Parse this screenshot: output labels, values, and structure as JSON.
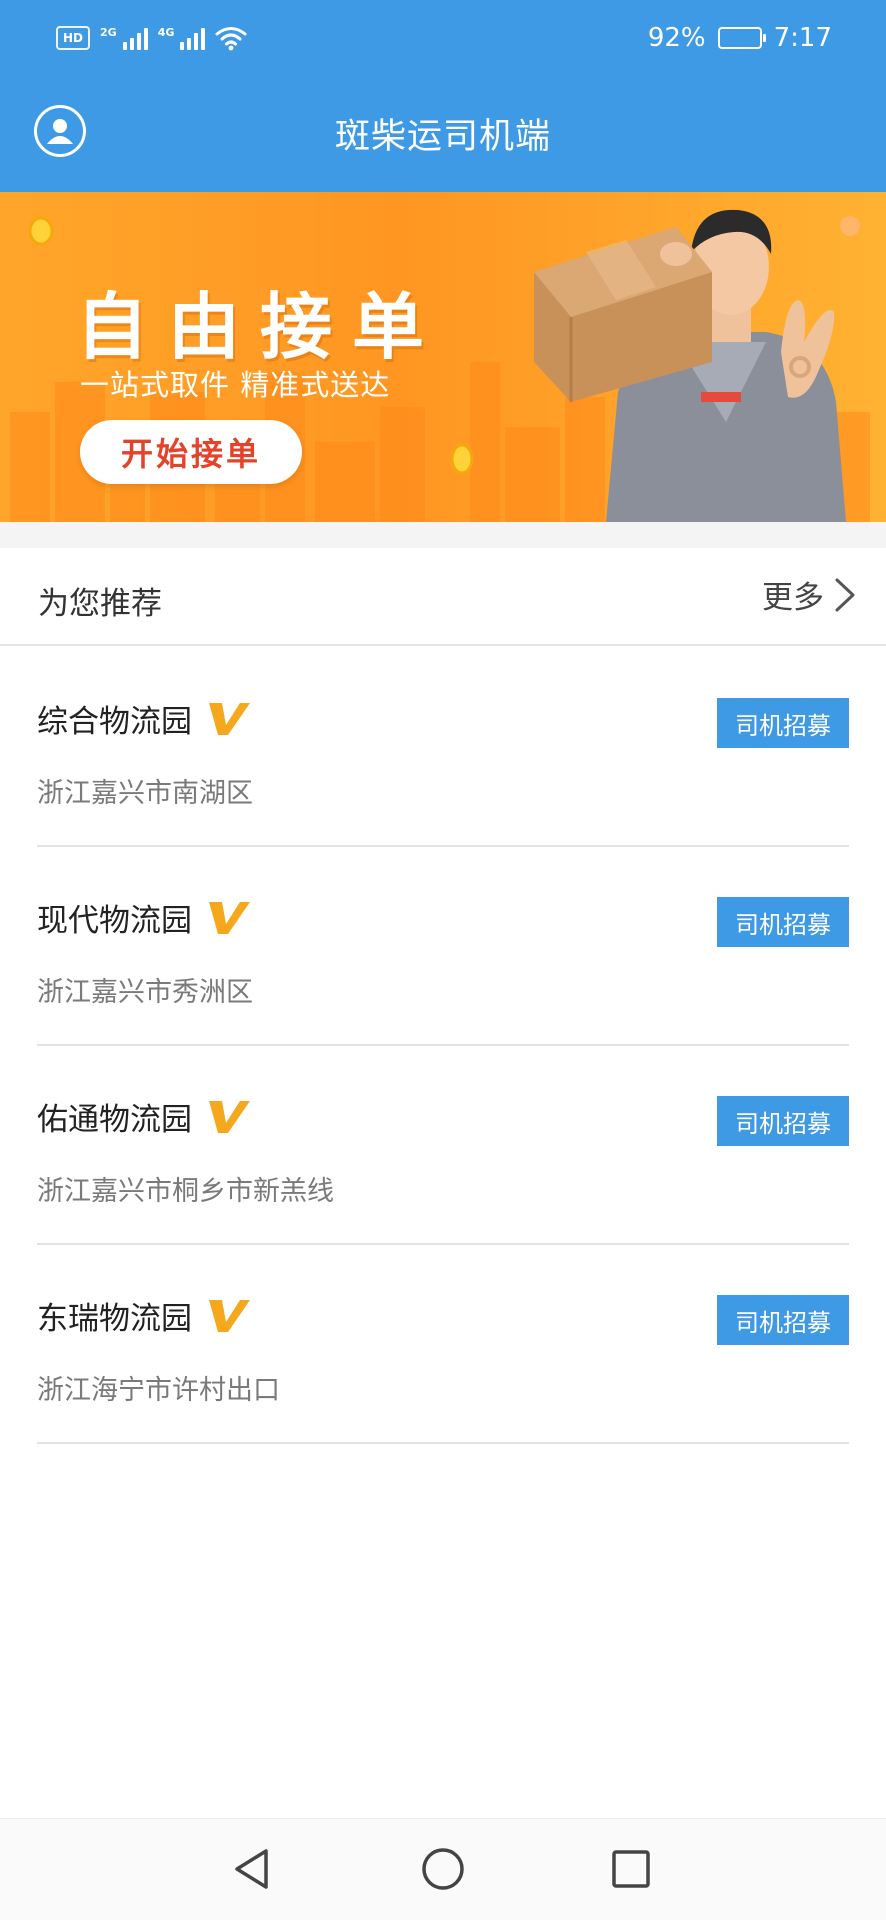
{
  "status_bar": {
    "hd_label": "HD",
    "hd_sub": "2",
    "net_1": "2G",
    "net_2": "4G",
    "battery_text": "92%",
    "battery_level": 0.92,
    "time": "7:17"
  },
  "header": {
    "title": "斑柴运司机端",
    "avatar_icon": "user-profile-icon"
  },
  "banner": {
    "headline": "自由接单",
    "subtitle": "一站式取件 精准式送达",
    "button_label": "开始接单"
  },
  "recommend": {
    "title": "为您推荐",
    "more_label": "更多",
    "more_icon": "chevron-right-icon",
    "items": [
      {
        "name": "综合物流园",
        "address": "浙江嘉兴市南湖区",
        "button": "司机招募"
      },
      {
        "name": "现代物流园",
        "address": "浙江嘉兴市秀洲区",
        "button": "司机招募"
      },
      {
        "name": "佑通物流园",
        "address": "浙江嘉兴市桐乡市新羔线",
        "button": "司机招募"
      },
      {
        "name": "东瑞物流园",
        "address": "浙江海宁市许村出口",
        "button": "司机招募"
      }
    ]
  },
  "colors": {
    "primary_blue": "#3f9ae6",
    "banner_orange": "#ff9a24",
    "verified_gold": "#f6a81c"
  }
}
